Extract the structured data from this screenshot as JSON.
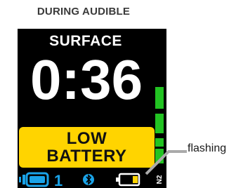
{
  "heading": "DURING AUDIBLE",
  "display": {
    "mode": "SURFACE",
    "time": "0:36",
    "alert": {
      "line1": "LOW",
      "line2": "BATTERY"
    },
    "status": {
      "transmitter_number": "1",
      "icons": [
        "transmitter-icon",
        "bluetooth-icon",
        "battery-low-icon"
      ],
      "gas_label": "N2"
    },
    "tissue_bars_lit": 4
  },
  "callout": {
    "label": "flashing"
  },
  "colors": {
    "screen_bg": "#000000",
    "alert_bg": "#ffd400",
    "bar_green": "#22c322",
    "status_blue": "#1aa3e8",
    "battery_yellow": "#ffd400"
  }
}
